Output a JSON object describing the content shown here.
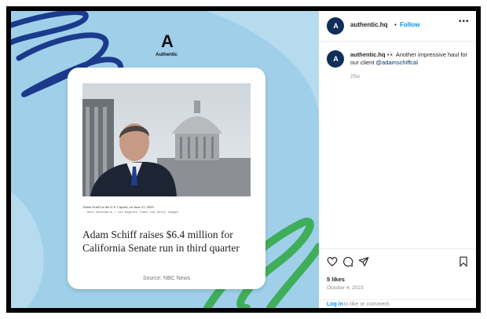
{
  "header": {
    "avatar_text": "A",
    "username": "authentic.hq",
    "separator": "•",
    "follow_label": "Follow",
    "more_label": "•••"
  },
  "media": {
    "brand_mark": "A",
    "brand_word": "Authentic",
    "card": {
      "photo_caption": "Adam Schiff at the U.S. Capitol, on June 21, 2023.",
      "photo_credit": "Kent Nishimura / Los Angeles Times via Getty Images",
      "headline": "Adam Schiff raises $6.4 million for California Senate run in third quarter",
      "source": "Source: NBC News"
    },
    "colors": {
      "background": "#9fcfe9",
      "scribble_navy": "#1c3a8c",
      "scribble_green": "#3fae5a"
    }
  },
  "comment": {
    "username": "authentic.hq",
    "emoji": "👀",
    "text": "Another impressive haul for our client",
    "mention": "@adamschiffcal",
    "time": "25w"
  },
  "actions": {
    "icons": [
      "heart-icon",
      "comment-icon",
      "share-icon",
      "bookmark-icon"
    ],
    "likes": "5 likes",
    "date": "October 4, 2023"
  },
  "login": {
    "link_label": "Log in",
    "rest_text": "to like or comment."
  }
}
